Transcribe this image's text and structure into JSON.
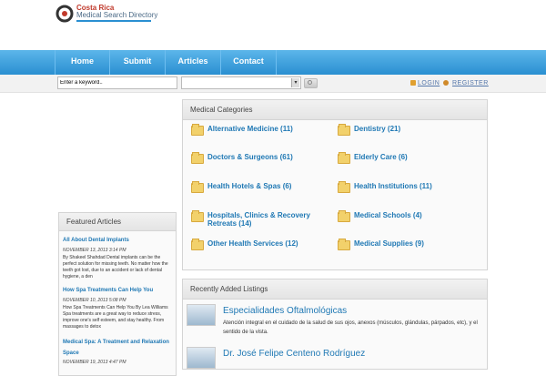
{
  "brand": {
    "title": "Costa Rica",
    "subtitle": "Medical Search Directory"
  },
  "nav": {
    "items": [
      "Home",
      "Submit",
      "Articles",
      "Contact"
    ]
  },
  "search": {
    "keyword_value": "Enter a keyword..",
    "category_value": ""
  },
  "account": {
    "login_label": "LOGIN",
    "register_label": "REGISTER"
  },
  "categories": {
    "heading": "Medical Categories",
    "items": [
      "Alternative Medicine (11)",
      "Dentistry (21)",
      "Doctors & Surgeons (61)",
      "Elderly Care (6)",
      "Health Hotels & Spas (6)",
      "Health Institutions (11)",
      "Hospitals, Clinics & Recovery Retreats (14)",
      "Medical Schools (4)",
      "Other Health Services (12)",
      "Medical Supplies (9)"
    ]
  },
  "recent": {
    "heading": "Recently Added Listings",
    "listings": [
      {
        "title": "Especialidades Oftalmológicas",
        "description": "Atención integral en el cuidado de la salud de sus ojos, anexos (músculos, glándulas, párpados, etc), y el sentido de la vista."
      },
      {
        "title": "Dr. José Felipe Centeno Rodríguez",
        "description": ""
      }
    ]
  },
  "featured": {
    "heading": "Featured Articles",
    "articles": [
      {
        "title": "All About Dental Implants",
        "date": "NOVEMBER 13, 2013 3:14 PM",
        "excerpt": "By Shakeel Shahdad Dental implants can be the perfect solution for missing teeth. No matter how the teeth got lost, due to an accident or lack of dental hygiene, a den"
      },
      {
        "title": "How Spa Treatments Can Help You",
        "date": "NOVEMBER 10, 2013 5:08 PM",
        "excerpt": "How Spa Treatments Can Help You By Lea Williams Spa treatments are a great way to reduce stress, improve one's self esteem, and stay healthy. From massages to detox"
      },
      {
        "title": "Medical Spa: A Treatment and Relaxation Space",
        "date": "NOVEMBER 19, 2013 4:47 PM",
        "excerpt": ""
      }
    ]
  },
  "colors": {
    "nav_blue": "#2a8fd1",
    "link_blue": "#1f78b4",
    "brand_red": "#c0392b"
  }
}
